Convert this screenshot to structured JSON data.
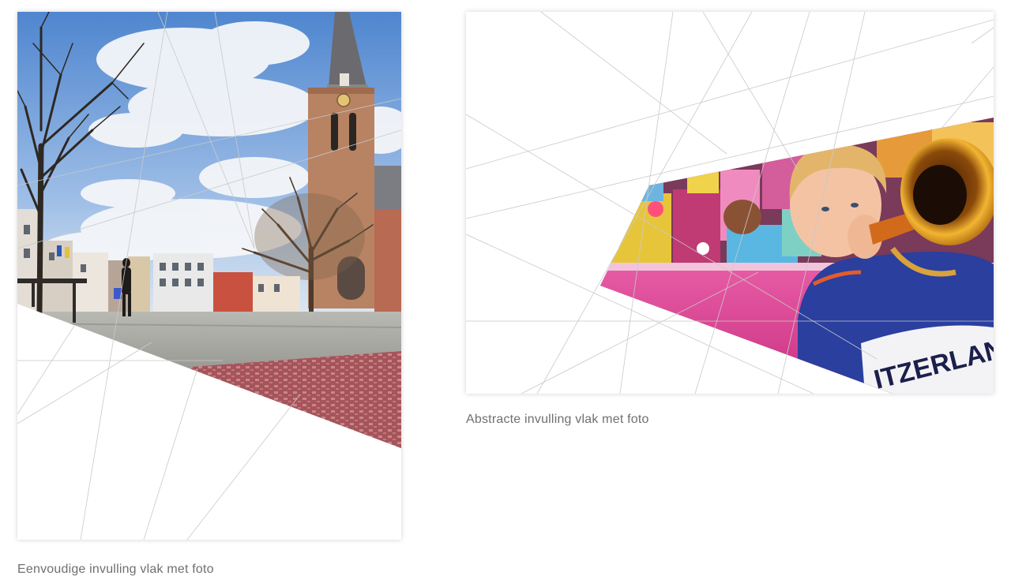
{
  "examples": [
    {
      "caption": "Eenvoudige invulling vlak met foto",
      "photo": "town-square-church-tower-photo"
    },
    {
      "caption": "Abstracte invulling vlak met foto",
      "photo": "child-playing-trumpet-photo"
    }
  ],
  "colors": {
    "caption_text": "#6f6f6f",
    "line": "#c9c9c9",
    "sky": "#7ea6d9",
    "brick": "#b5654a",
    "pink": "#d9438f",
    "hoodie_blue": "#2a3f9e",
    "brass": "#e0a52a"
  }
}
